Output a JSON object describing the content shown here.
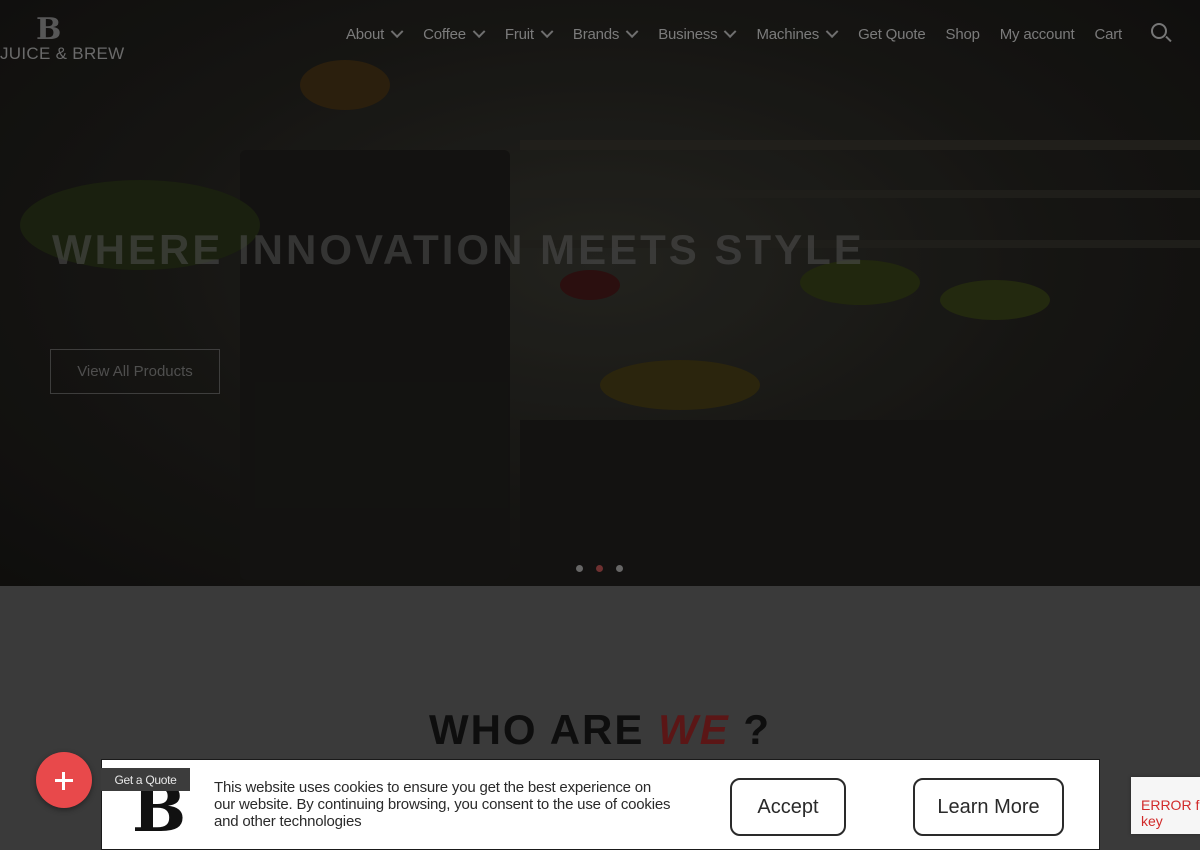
{
  "logo": {
    "mark": "B",
    "brand": "JUICE & BREW"
  },
  "nav": {
    "items": [
      {
        "label": "About",
        "dropdown": true
      },
      {
        "label": "Coffee",
        "dropdown": true
      },
      {
        "label": "Fruit",
        "dropdown": true
      },
      {
        "label": "Brands",
        "dropdown": true
      },
      {
        "label": "Business",
        "dropdown": true
      },
      {
        "label": "Machines",
        "dropdown": true
      },
      {
        "label": "Get Quote",
        "dropdown": false
      },
      {
        "label": "Shop",
        "dropdown": false
      },
      {
        "label": "My account",
        "dropdown": false
      },
      {
        "label": "Cart",
        "dropdown": false
      }
    ],
    "search_icon": "search-icon"
  },
  "hero": {
    "title": "WHERE INNOVATION MEETS STYLE",
    "button_label": "View All Products",
    "slides": 3,
    "active_slide": 2
  },
  "section": {
    "heading_part1": "WHO ARE",
    "heading_accent": "WE",
    "heading_part2": "?"
  },
  "fab": {
    "icon": "plus-icon",
    "label": "Get a Quote"
  },
  "cookie": {
    "logo": "B",
    "text": "This website uses cookies to ensure you get the best experience on our website. By continuing browsing, you consent to the use of cookies and other technologies",
    "accept_label": "Accept",
    "learn_more_label": "Learn More"
  },
  "recaptcha": {
    "error": "ERROR for site key"
  },
  "colors": {
    "fab": "#e8494b",
    "accent": "#5b1616",
    "page_bg": "#3a3a3a"
  }
}
